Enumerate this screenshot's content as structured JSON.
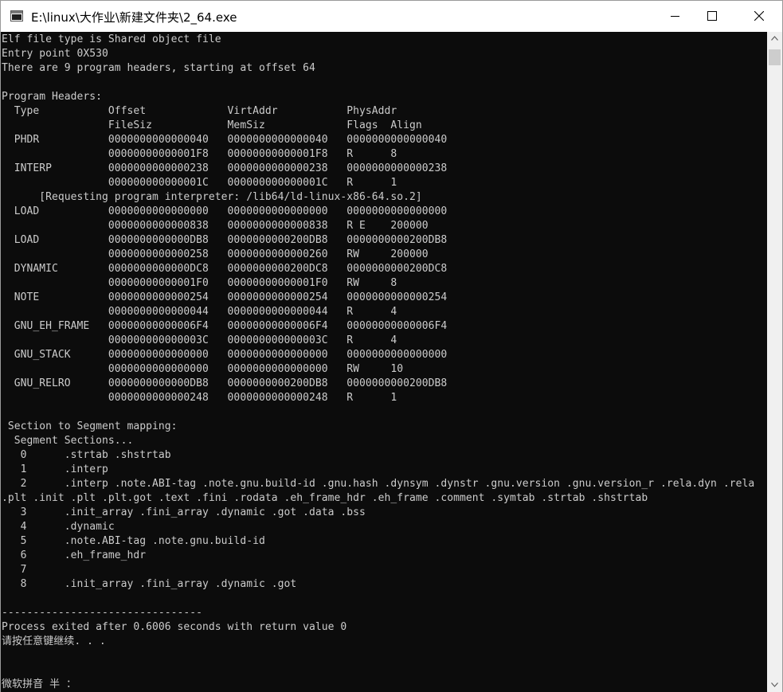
{
  "window": {
    "title": "E:\\linux\\大作业\\新建文件夹\\2_64.exe",
    "icon": "console-app-icon",
    "controls": {
      "minimize": "minimize-icon",
      "maximize": "maximize-icon",
      "close": "close-icon"
    }
  },
  "console": {
    "lines": [
      "Elf file type is Shared object file",
      "Entry point 0X530",
      "There are 9 program headers, starting at offset 64",
      "",
      "Program Headers:",
      "  Type           Offset             VirtAddr           PhysAddr",
      "                 FileSiz            MemSiz             Flags  Align",
      "  PHDR           0000000000000040   0000000000000040   0000000000000040",
      "                 00000000000001F8   00000000000001F8   R      8",
      "  INTERP         0000000000000238   0000000000000238   0000000000000238",
      "                 000000000000001C   000000000000001C   R      1",
      "      [Requesting program interpreter: /lib64/ld-linux-x86-64.so.2]",
      "  LOAD           0000000000000000   0000000000000000   0000000000000000",
      "                 0000000000000838   0000000000000838   R E    200000",
      "  LOAD           0000000000000DB8   0000000000200DB8   0000000000200DB8",
      "                 0000000000000258   0000000000000260   RW     200000",
      "  DYNAMIC        0000000000000DC8   0000000000200DC8   0000000000200DC8",
      "                 00000000000001F0   00000000000001F0   RW     8",
      "  NOTE           0000000000000254   0000000000000254   0000000000000254",
      "                 0000000000000044   0000000000000044   R      4",
      "  GNU_EH_FRAME   00000000000006F4   00000000000006F4   00000000000006F4",
      "                 000000000000003C   000000000000003C   R      4",
      "  GNU_STACK      0000000000000000   0000000000000000   0000000000000000",
      "                 0000000000000000   0000000000000000   RW     10",
      "  GNU_RELRO      0000000000000DB8   0000000000200DB8   0000000000200DB8",
      "                 0000000000000248   0000000000000248   R      1",
      "",
      " Section to Segment mapping:",
      "  Segment Sections...",
      "   0      .strtab .shstrtab",
      "   1      .interp",
      "   2      .interp .note.ABI-tag .note.gnu.build-id .gnu.hash .dynsym .dynstr .gnu.version .gnu.version_r .rela.dyn .rela",
      ".plt .init .plt .plt.got .text .fini .rodata .eh_frame_hdr .eh_frame .comment .symtab .strtab .shstrtab",
      "   3      .init_array .fini_array .dynamic .got .data .bss",
      "   4      .dynamic",
      "   5      .note.ABI-tag .note.gnu.build-id",
      "   6      .eh_frame_hdr",
      "   7",
      "   8      .init_array .fini_array .dynamic .got",
      "",
      "--------------------------------",
      "Process exited after 0.6006 seconds with return value 0",
      "请按任意键继续. . .",
      "",
      "",
      "微软拼音 半 ："
    ]
  },
  "scrollbar": {
    "up_icon": "scroll-up-arrow-icon",
    "down_icon": "scroll-down-arrow-icon"
  }
}
